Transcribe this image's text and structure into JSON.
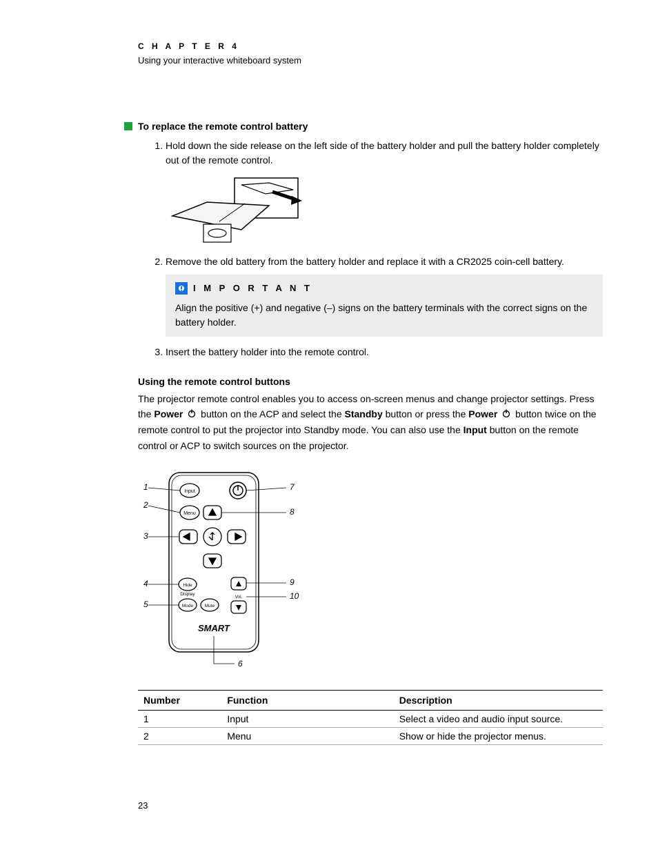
{
  "chapter": {
    "label": "C H A P T E R   4",
    "subtitle": "Using your interactive whiteboard system"
  },
  "section1": {
    "title": "To replace the remote control battery",
    "steps": [
      "Hold down the side release on the left side of the battery holder and pull the battery holder completely out of the remote control.",
      "Remove the old battery from the battery holder and replace it with a CR2025 coin-cell battery.",
      "Insert the battery holder into the remote control."
    ]
  },
  "callout": {
    "title": "I M P O R T A N T",
    "body": "Align the positive (+) and negative (–) signs on the battery terminals with the correct signs on the battery holder."
  },
  "section2": {
    "title": "Using the remote control buttons",
    "para_parts": {
      "p1": "The projector remote control enables you to access on-screen menus and change projector settings. Press the ",
      "power1": "Power",
      "p2": " button on the ACP and select the ",
      "standby": "Standby",
      "p3": " button or press the ",
      "power2": "Power",
      "p4": " button twice on the remote control to put the projector into Standby mode. You can also use the ",
      "input": "Input",
      "p5": " button on the remote control or ACP to switch sources on the projector."
    }
  },
  "remote_labels": {
    "l1": "1",
    "l2": "2",
    "l3": "3",
    "l4": "4",
    "l5": "5",
    "l6": "6",
    "l7": "7",
    "l8": "8",
    "l9": "9",
    "l10": "10",
    "btn_input": "Input",
    "btn_menu": "Menu",
    "btn_hide": "Hide",
    "btn_display": "Display",
    "btn_mode": "Mode",
    "btn_mute": "Mute",
    "vol": "Vol.",
    "brand": "SMART"
  },
  "table": {
    "headers": {
      "num": "Number",
      "func": "Function",
      "desc": "Description"
    },
    "rows": [
      {
        "num": "1",
        "func": "Input",
        "desc": "Select a video and audio input source."
      },
      {
        "num": "2",
        "func": "Menu",
        "desc": "Show or hide the projector menus."
      }
    ]
  },
  "page_number": "23"
}
